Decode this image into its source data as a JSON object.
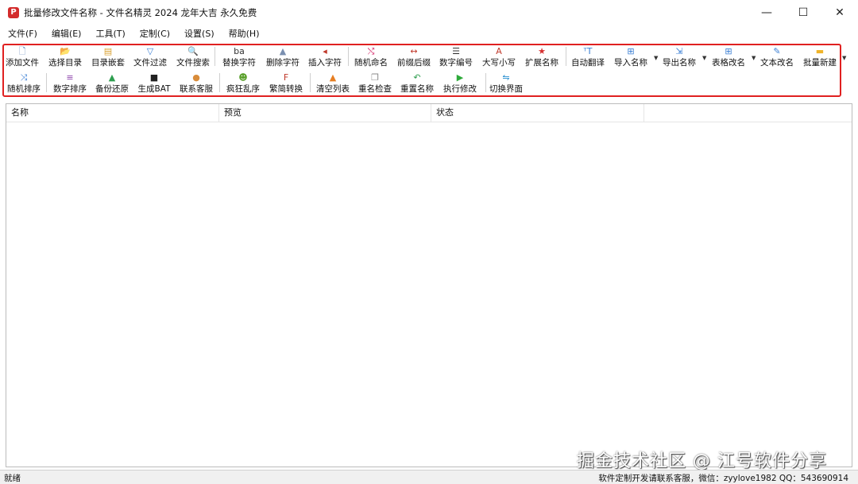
{
  "window": {
    "title": "批量修改文件名称 - 文件名精灵 2024 龙年大吉 永久免费",
    "app_icon_glyph": "P",
    "minimize": "—",
    "maximize": "☐",
    "close": "✕"
  },
  "menu": [
    "文件(F)",
    "编辑(E)",
    "工具(T)",
    "定制(C)",
    "设置(S)",
    "帮助(H)"
  ],
  "toolbar": {
    "row1": [
      {
        "label": "添加文件",
        "icon": "add-file-icon",
        "glyph": "🗋",
        "color": "#5a7fb8"
      },
      {
        "label": "选择目录",
        "icon": "folder-open-icon",
        "glyph": "📂",
        "color": "#e0a020"
      },
      {
        "label": "目录嵌套",
        "icon": "nested-folder-icon",
        "glyph": "▤",
        "color": "#d9a030"
      },
      {
        "label": "文件过滤",
        "icon": "filter-icon",
        "glyph": "▽",
        "color": "#3b7fd4"
      },
      {
        "label": "文件搜索",
        "icon": "search-icon",
        "glyph": "🔍",
        "color": "#666666"
      },
      {
        "label": "替换字符",
        "icon": "replace-text-icon",
        "glyph": "ba",
        "color": "#333333"
      },
      {
        "label": "删除字符",
        "icon": "delete-text-icon",
        "glyph": "▲",
        "color": "#7a8fb0"
      },
      {
        "label": "插入字符",
        "icon": "insert-text-icon",
        "glyph": "◂",
        "color": "#c0392b"
      },
      {
        "label": "随机命名",
        "icon": "shuffle-icon",
        "glyph": "⤭",
        "color": "#d62f6e"
      },
      {
        "label": "前缀后缀",
        "icon": "prefix-suffix-icon",
        "glyph": "↔",
        "color": "#c0392b"
      },
      {
        "label": "数字编号",
        "icon": "numbered-list-icon",
        "glyph": "☰",
        "color": "#333333"
      },
      {
        "label": "大写小写",
        "icon": "case-icon",
        "glyph": "A",
        "color": "#c0392b"
      },
      {
        "label": "扩展名称",
        "icon": "star-icon",
        "glyph": "★",
        "color": "#d63030"
      },
      {
        "label": "自动翻译",
        "icon": "translate-icon",
        "glyph": "ᵀT",
        "color": "#3b7fd4"
      },
      {
        "label": "导入名称",
        "icon": "import-icon",
        "glyph": "⊞",
        "color": "#3b7fd4"
      },
      {
        "label": "导出名称",
        "icon": "export-icon",
        "glyph": "⇲",
        "color": "#3b7fd4"
      },
      {
        "label": "表格改名",
        "icon": "table-icon",
        "glyph": "⊞",
        "color": "#3b7fd4"
      },
      {
        "label": "文本改名",
        "icon": "edit-text-icon",
        "glyph": "✎",
        "color": "#3b7fd4"
      },
      {
        "label": "批量新建",
        "icon": "new-folder-icon",
        "glyph": "▬",
        "color": "#f0b429"
      }
    ],
    "row2": [
      {
        "label": "随机排序",
        "icon": "random-sort-icon",
        "glyph": "⤨",
        "color": "#3b7fd4"
      },
      {
        "label": "数字排序",
        "icon": "number-sort-icon",
        "glyph": "≡",
        "color": "#8e44ad"
      },
      {
        "label": "备份还原",
        "icon": "backup-icon",
        "glyph": "▲",
        "color": "#2e9e4f"
      },
      {
        "label": "生成BAT",
        "icon": "terminal-icon",
        "glyph": "■",
        "color": "#222222"
      },
      {
        "label": "联系客服",
        "icon": "support-icon",
        "glyph": "●",
        "color": "#d98c3a"
      },
      {
        "label": "疯狂乱序",
        "icon": "frog-icon",
        "glyph": "☻",
        "color": "#5aa02c"
      },
      {
        "label": "繁简转换",
        "icon": "convert-icon",
        "glyph": "F",
        "color": "#c0392b"
      },
      {
        "label": "清空列表",
        "icon": "clear-icon",
        "glyph": "▲",
        "color": "#e67e22"
      },
      {
        "label": "重名检查",
        "icon": "duplicate-check-icon",
        "glyph": "❐",
        "color": "#888888"
      },
      {
        "label": "重置名称",
        "icon": "reset-icon",
        "glyph": "↶",
        "color": "#2e9e4f"
      },
      {
        "label": "执行修改",
        "icon": "play-icon",
        "glyph": "▶",
        "color": "#2eaa3a"
      },
      {
        "label": "切换界面",
        "icon": "switch-ui-icon",
        "glyph": "⇋",
        "color": "#2a8fd0"
      }
    ]
  },
  "list": {
    "columns": [
      "名称",
      "预览",
      "状态"
    ]
  },
  "watermark": "掘金技术社区 @ 江号软件分享",
  "status": {
    "left": "就绪",
    "right": "软件定制开发请联系客服，微信：zyylove1982  QQ：543690914"
  }
}
